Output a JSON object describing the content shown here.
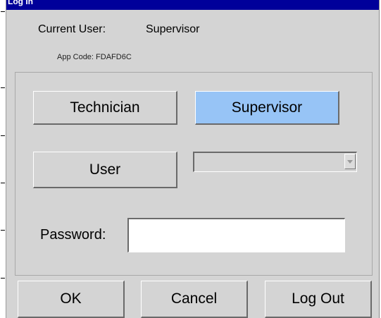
{
  "window": {
    "title": "Log In"
  },
  "current_user": {
    "label": "Current User:",
    "value": "Supervisor"
  },
  "app_code": "App Code: FDAFD6C",
  "roles": {
    "technician": "Technician",
    "supervisor": "Supervisor",
    "user": "User",
    "selected": "Supervisor"
  },
  "user_select": {
    "value": ""
  },
  "password": {
    "label": "Password:",
    "value": ""
  },
  "actions": {
    "ok": "OK",
    "cancel": "Cancel",
    "logout": "Log Out"
  },
  "colors": {
    "titlebar": "#00009a",
    "selected_button": "#97c4f6",
    "dialog_bg": "#d4d4d4"
  }
}
